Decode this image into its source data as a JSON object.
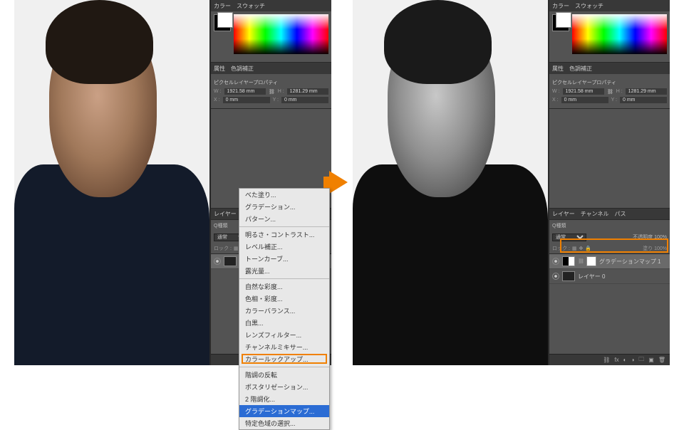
{
  "panels": {
    "color_tab": "カラー",
    "swatch_tab": "スウォッチ",
    "props_tab": "属性",
    "adjust_tab": "色調補正",
    "props_title": "ピクセルレイヤープロパティ",
    "w_lbl": "W :",
    "w_val": "1921.58 mm",
    "h_lbl": "H :",
    "h_val": "1281.29 mm",
    "x_lbl": "X :",
    "x_val": "0 mm",
    "y_lbl": "Y :",
    "y_val": "0 mm",
    "layers_tab": "レイヤー",
    "channels_tab": "チャンネル",
    "paths_tab": "パス",
    "kind_lbl": "Q種類",
    "blend": "通常",
    "opacity_lbl": "不透明度",
    "opacity_val": "100%",
    "lock_lbl": "ロック :",
    "fill_lbl": "塗り",
    "fill_val": "100%",
    "layer0": "レイヤー 0",
    "gradmap_layer": "グラデーションマップ 1"
  },
  "menu": {
    "items": [
      {
        "t": "べた塗り...",
        "g": 0
      },
      {
        "t": "グラデーション...",
        "g": 0
      },
      {
        "t": "パターン...",
        "g": 0
      },
      {
        "t": "明るさ・コントラスト...",
        "g": 1
      },
      {
        "t": "レベル補正...",
        "g": 1
      },
      {
        "t": "トーンカーブ...",
        "g": 1
      },
      {
        "t": "露光量...",
        "g": 1
      },
      {
        "t": "自然な彩度...",
        "g": 2
      },
      {
        "t": "色相・彩度...",
        "g": 2
      },
      {
        "t": "カラーバランス...",
        "g": 2
      },
      {
        "t": "白黒...",
        "g": 2
      },
      {
        "t": "レンズフィルター...",
        "g": 2
      },
      {
        "t": "チャンネルミキサー...",
        "g": 2
      },
      {
        "t": "カラールックアップ...",
        "g": 2
      },
      {
        "t": "階調の反転",
        "g": 3
      },
      {
        "t": "ポスタリゼーション...",
        "g": 3
      },
      {
        "t": "2 階調化...",
        "g": 3
      },
      {
        "t": "グラデーションマップ...",
        "g": 3,
        "sel": true
      },
      {
        "t": "特定色域の選択...",
        "g": 3
      }
    ]
  }
}
